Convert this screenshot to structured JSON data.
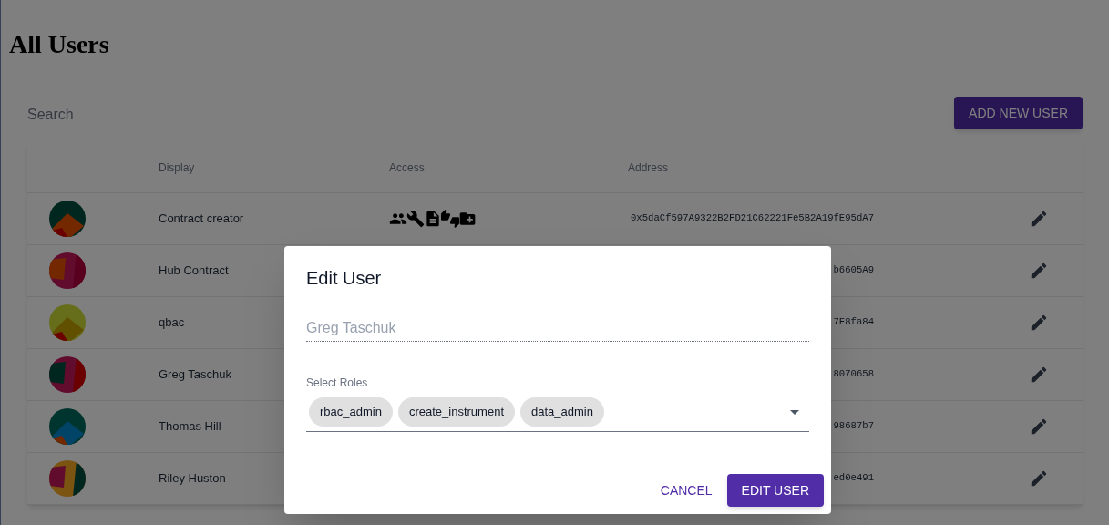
{
  "page": {
    "title": "All Users"
  },
  "search": {
    "placeholder": "Search"
  },
  "add_button": {
    "label": "ADD NEW USER"
  },
  "table": {
    "columns": [
      "Display",
      "Access",
      "Address"
    ],
    "rows": [
      {
        "display": "Contract creator",
        "address": "0x5daCf597A9322B2FD21C62221Fe5B2A19fE95dA7",
        "access": [
          {
            "kind": "users"
          },
          {
            "kind": "tools"
          },
          {
            "kind": "document"
          },
          {
            "kind": "votes"
          },
          {
            "kind": "new-folder"
          }
        ]
      },
      {
        "display": "Hub Contract",
        "address": "b6605A9"
      },
      {
        "display": "qbac",
        "address": "7F8fa84"
      },
      {
        "display": "Greg Taschuk",
        "address": "8070658"
      },
      {
        "display": "Thomas Hill",
        "address": "98687b7"
      },
      {
        "display": "Riley Huston",
        "address": "ed0e491"
      }
    ]
  },
  "dialog": {
    "title": "Edit User",
    "name_field": {
      "value": "Greg Taschuk",
      "disabled": true
    },
    "roles": {
      "label": "Select Roles",
      "chips": [
        "rbac_admin",
        "create_instrument",
        "data_admin"
      ]
    },
    "buttons": [
      {
        "label": "CANCEL",
        "kind": "text"
      },
      {
        "label": "EDIT USER",
        "kind": "contained"
      }
    ]
  }
}
